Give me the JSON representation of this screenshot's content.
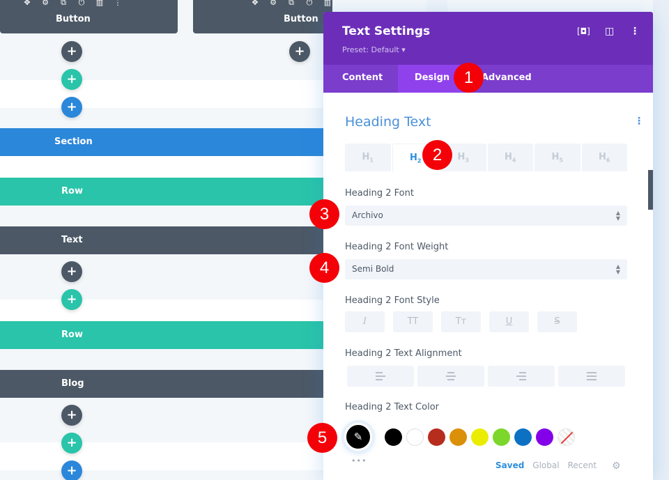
{
  "canvas": {
    "module_cards": [
      {
        "label": "Button",
        "toolbar_icons": [
          "move-icon",
          "gear-icon",
          "duplicate-icon",
          "power-icon",
          "columns-icon",
          "more-icon"
        ]
      },
      {
        "label": "Button",
        "toolbar_icons": [
          "move-icon",
          "gear-icon",
          "duplicate-icon",
          "power-icon",
          "columns-icon"
        ]
      }
    ],
    "bars": [
      {
        "type": "section",
        "label": "Section"
      },
      {
        "type": "row",
        "label": "Row"
      },
      {
        "type": "module",
        "label": "Text"
      },
      {
        "type": "row",
        "label": "Row"
      },
      {
        "type": "module",
        "label": "Blog"
      }
    ],
    "add_button_glyph": "+",
    "colors": {
      "section": "#2b87da",
      "row": "#29c4a9",
      "module": "#4c5866"
    }
  },
  "modal": {
    "title": "Text Settings",
    "preset": "Preset: Default ▾",
    "header_icons": [
      "expand-icon",
      "split-view-icon",
      "more-options-icon"
    ],
    "tabs": [
      {
        "label": "Content",
        "active": false
      },
      {
        "label": "Design",
        "active": true
      },
      {
        "label": "Advanced",
        "active": false
      }
    ],
    "group": {
      "title": "Heading Text",
      "heading_tabs": [
        {
          "label": "H",
          "sub": "1",
          "active": false
        },
        {
          "label": "H",
          "sub": "2",
          "active": true
        },
        {
          "label": "H",
          "sub": "3",
          "active": false
        },
        {
          "label": "H",
          "sub": "4",
          "active": false
        },
        {
          "label": "H",
          "sub": "5",
          "active": false
        },
        {
          "label": "H",
          "sub": "6",
          "active": false
        }
      ],
      "font_label": "Heading 2 Font",
      "font_value": "Archivo",
      "weight_label": "Heading 2 Font Weight",
      "weight_value": "Semi Bold",
      "style_label": "Heading 2 Font Style",
      "style_buttons": [
        {
          "name": "italic",
          "glyph": "I"
        },
        {
          "name": "uppercase",
          "glyph": "TT"
        },
        {
          "name": "capitalize",
          "glyph": "Tт"
        },
        {
          "name": "underline",
          "glyph": "U"
        },
        {
          "name": "strikethrough",
          "glyph": "S"
        }
      ],
      "alignment_label": "Heading 2 Text Alignment",
      "alignment_buttons": [
        "left",
        "center",
        "right",
        "justify"
      ],
      "color_label": "Heading 2 Text Color",
      "selected_color": "#000000",
      "swatches": [
        "#000000",
        "#ffffff",
        "#b62d1e",
        "#db9009",
        "#ebed00",
        "#7cd72a",
        "#0c71c3",
        "#8300e9",
        "transparent"
      ],
      "palette_tabs": [
        {
          "label": "Saved",
          "active": true
        },
        {
          "label": "Global",
          "active": false
        },
        {
          "label": "Recent",
          "active": false
        }
      ],
      "more_dots": "•••"
    }
  },
  "markers": [
    "1",
    "2",
    "3",
    "4",
    "5"
  ]
}
